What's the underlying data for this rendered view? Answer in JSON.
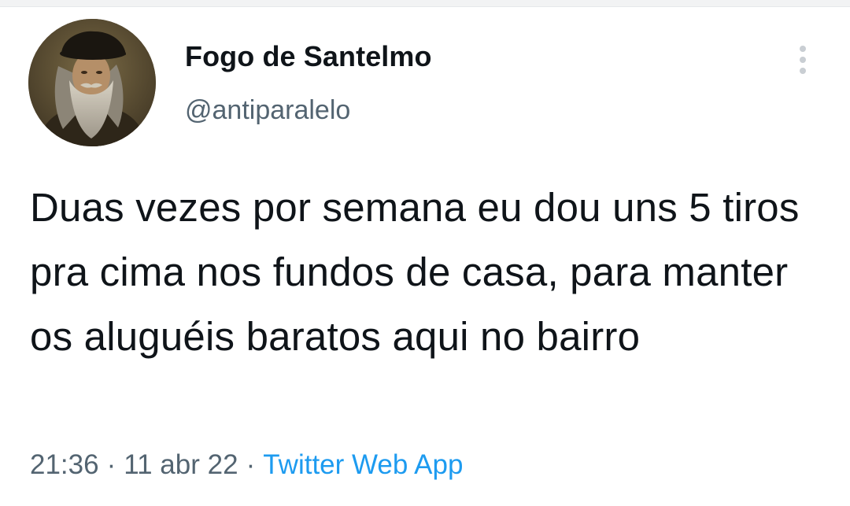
{
  "tweet": {
    "author": {
      "display_name": "Fogo de Santelmo",
      "handle": "@antiparalelo",
      "avatar_icon": "bearded-man-portrait-avatar"
    },
    "text": "Duas vezes por semana eu dou uns 5 tiros pra cima nos fundos de casa, para manter os aluguéis baratos aqui no bairro",
    "time": "21:36",
    "date": "11 abr 22",
    "separator": "·",
    "source": "Twitter Web App",
    "more_icon": "more-vertical-icon"
  },
  "colors": {
    "text": "#0f1419",
    "secondary": "#536471",
    "link": "#1d9bf0",
    "background": "#ffffff"
  }
}
